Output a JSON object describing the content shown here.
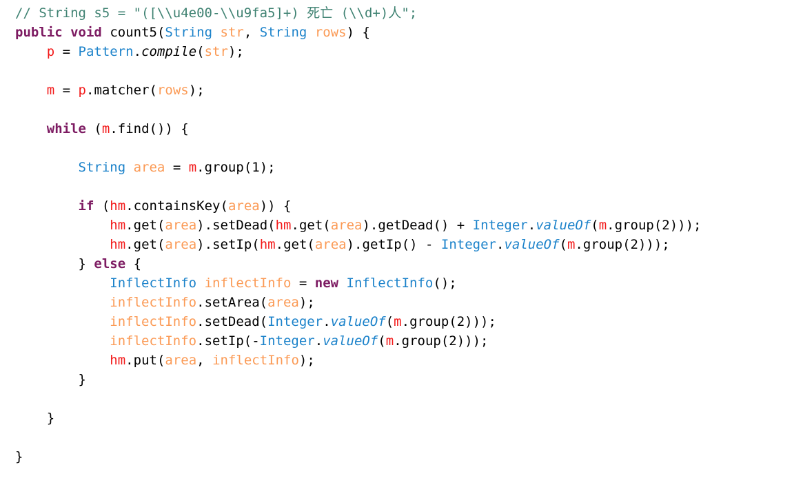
{
  "editor": {
    "language": "Java",
    "background_color": "#ffffff",
    "font_size_px": 19,
    "line_height_px": 28,
    "colors": {
      "plain": "#000000",
      "comment": "#3f8272",
      "keyword": "#7d1b62",
      "type": "#1b82ca",
      "field": "#f21919",
      "parameter": "#fb9a55",
      "static_method": "#1b82ca"
    }
  },
  "code": {
    "line_count": 24,
    "lines": [
      {
        "n": 1,
        "indent": "",
        "text": "// String s5 = \"([\\\\u4e00-\\\\u9fa5]+) 死亡 (\\\\d+)人\";"
      },
      {
        "n": 2,
        "indent": "",
        "text": "public void count5(String str, String rows) {"
      },
      {
        "n": 3,
        "indent": "    ",
        "text": "p = Pattern.compile(str);"
      },
      {
        "n": 4,
        "indent": "",
        "text": ""
      },
      {
        "n": 5,
        "indent": "    ",
        "text": "m = p.matcher(rows);"
      },
      {
        "n": 6,
        "indent": "",
        "text": ""
      },
      {
        "n": 7,
        "indent": "    ",
        "text": "while (m.find()) {"
      },
      {
        "n": 8,
        "indent": "",
        "text": ""
      },
      {
        "n": 9,
        "indent": "        ",
        "text": "String area = m.group(1);"
      },
      {
        "n": 10,
        "indent": "",
        "text": ""
      },
      {
        "n": 11,
        "indent": "        ",
        "text": "if (hm.containsKey(area)) {"
      },
      {
        "n": 12,
        "indent": "            ",
        "text": "hm.get(area).setDead(hm.get(area).getDead() + Integer.valueOf(m.group(2)));"
      },
      {
        "n": 13,
        "indent": "            ",
        "text": "hm.get(area).setIp(hm.get(area).getIp() - Integer.valueOf(m.group(2)));"
      },
      {
        "n": 14,
        "indent": "        ",
        "text": "} else {"
      },
      {
        "n": 15,
        "indent": "            ",
        "text": "InflectInfo inflectInfo = new InflectInfo();"
      },
      {
        "n": 16,
        "indent": "            ",
        "text": "inflectInfo.setArea(area);"
      },
      {
        "n": 17,
        "indent": "            ",
        "text": "inflectInfo.setDead(Integer.valueOf(m.group(2)));"
      },
      {
        "n": 18,
        "indent": "            ",
        "text": "inflectInfo.setIp(-Integer.valueOf(m.group(2)));"
      },
      {
        "n": 19,
        "indent": "            ",
        "text": "hm.put(area, inflectInfo);"
      },
      {
        "n": 20,
        "indent": "        ",
        "text": "}"
      },
      {
        "n": 21,
        "indent": "",
        "text": ""
      },
      {
        "n": 22,
        "indent": "    ",
        "text": "}"
      },
      {
        "n": 23,
        "indent": "",
        "text": ""
      },
      {
        "n": 24,
        "indent": "",
        "text": "}"
      }
    ],
    "tokens": {
      "comment_line": "// String s5 = \"([\\\\u4e00-\\\\u9fa5]+) 死亡 (\\\\d+)人\";",
      "comment_cjk_1": "死亡",
      "comment_cjk_2": "人",
      "kw_public": "public",
      "kw_void": "void",
      "kw_while": "while",
      "kw_if": "if",
      "kw_else": "else",
      "kw_new": "new",
      "type_String": "String",
      "type_Pattern": "Pattern",
      "type_Integer": "Integer",
      "type_InflectInfo": "InflectInfo",
      "field_p": "p",
      "field_m": "m",
      "field_hm": "hm",
      "param_str": "str",
      "param_rows": "rows",
      "var_area": "area",
      "var_inflectInfo": "inflectInfo",
      "method_count5": "count5",
      "method_compile": "compile",
      "method_matcher": "matcher",
      "method_find": "find",
      "method_group": "group",
      "method_containsKey": "containsKey",
      "method_get": "get",
      "method_put": "put",
      "method_setDead": "setDead",
      "method_getDead": "getDead",
      "method_setIp": "setIp",
      "method_getIp": "getIp",
      "method_setArea": "setArea",
      "method_valueOf": "valueOf"
    }
  }
}
